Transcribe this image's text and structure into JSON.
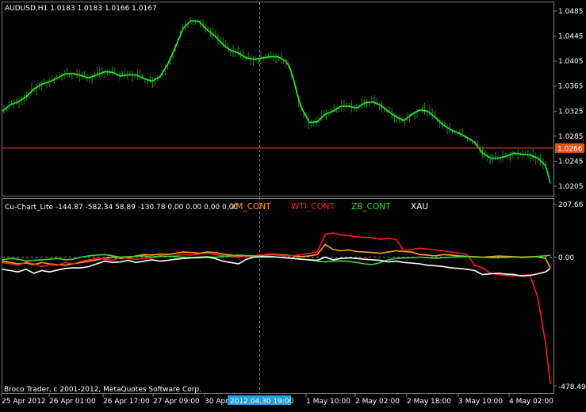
{
  "colors": {
    "background": "#000000",
    "frame": "#808080",
    "text": "#ffffff",
    "price": "#22ee22",
    "price_bars": "#1f8a1f",
    "current_price_line": "#e0531b",
    "current_price_badge": "#e0531b",
    "crosshair": "#5a8fd6",
    "date_highlight": "#1fa0e0",
    "ym": "#ff9f1a",
    "wti": "#ff1a1a",
    "zb": "#33dd33",
    "xau": "#ffffff"
  },
  "main": {
    "header": "AUDUSD,H1  1.0183 1.0183 1.0166 1.0167",
    "current_price": "1.0266",
    "price_axis": [
      "1.0485",
      "1.0445",
      "1.0405",
      "1.0365",
      "1.0325",
      "1.0285",
      "1.0245",
      "1.0205"
    ]
  },
  "sub": {
    "header": "Cu-Chart_Lite -144.87 -582.34 58.89 -130.78 0.00 0.00 0.00 0.00",
    "legend": [
      {
        "label": "YM_CONT",
        "color": "#ff9f1a"
      },
      {
        "label": "WTI_CONT",
        "color": "#ff1a1a"
      },
      {
        "label": "ZB_CONT",
        "color": "#33dd33"
      },
      {
        "label": "XAU",
        "color": "#ffffff"
      }
    ],
    "axis": {
      "top": "207.66",
      "zero": "0.00",
      "bottom": "-478.49"
    },
    "copyright": "Broco Trader, c 2001-2012, MetaQuotes Software Corp."
  },
  "time_axis": {
    "labels": [
      "25 Apr 2012",
      "26 Apr 01:00",
      "26 Apr 17:00",
      "27 Apr 09:00",
      "30 Apr",
      "1 May 10:00",
      "2 May 02:00",
      "2 May 18:00",
      "3 May 10:00",
      "4 May 02:00"
    ],
    "highlighted": "2012.04.30 19:00"
  },
  "chart_data": [
    {
      "type": "line",
      "title": "AUDUSD,H1",
      "ylim": [
        1.0195,
        1.0495
      ],
      "series": [
        {
          "name": "AUDUSD",
          "x": [
            0,
            10,
            20,
            30,
            40,
            50,
            60,
            70,
            80,
            90,
            100,
            110,
            120,
            130,
            140,
            150,
            160,
            170,
            180,
            190,
            200,
            210,
            220,
            230,
            240,
            250,
            260,
            270,
            280,
            290,
            300,
            310,
            320,
            330,
            340,
            350,
            360,
            365,
            370,
            375,
            380,
            390,
            400,
            410,
            420,
            430,
            440,
            450,
            460,
            470,
            480,
            490,
            500,
            510,
            520,
            530,
            540,
            550,
            560,
            570,
            580,
            590,
            600,
            610,
            620,
            630,
            640,
            650,
            660,
            670,
            680,
            690,
            696
          ],
          "y": [
            1.0325,
            1.0335,
            1.034,
            1.0348,
            1.036,
            1.0368,
            1.0372,
            1.0378,
            1.0385,
            1.0385,
            1.0382,
            1.0378,
            1.0383,
            1.0388,
            1.0387,
            1.0381,
            1.0383,
            1.0383,
            1.0377,
            1.0373,
            1.038,
            1.04,
            1.0428,
            1.0458,
            1.047,
            1.0468,
            1.0455,
            1.0445,
            1.0432,
            1.0422,
            1.0418,
            1.041,
            1.0408,
            1.041,
            1.0412,
            1.0412,
            1.0405,
            1.0395,
            1.0375,
            1.035,
            1.033,
            1.0307,
            1.0308,
            1.032,
            1.0325,
            1.0333,
            1.0333,
            1.033,
            1.0338,
            1.034,
            1.0335,
            1.0325,
            1.0316,
            1.031,
            1.032,
            1.0327,
            1.0325,
            1.0315,
            1.0303,
            1.0295,
            1.029,
            1.0283,
            1.0275,
            1.0258,
            1.025,
            1.025,
            1.0253,
            1.0258,
            1.0256,
            1.0255,
            1.025,
            1.0238,
            1.021
          ]
        }
      ]
    },
    {
      "type": "line",
      "title": "Cu-Chart_Lite",
      "ylim": [
        -478.49,
        207.66
      ],
      "x": [
        0,
        10,
        20,
        30,
        40,
        50,
        60,
        70,
        80,
        90,
        100,
        110,
        120,
        130,
        140,
        150,
        160,
        170,
        180,
        190,
        200,
        210,
        220,
        230,
        240,
        250,
        260,
        270,
        280,
        290,
        300,
        310,
        320,
        330,
        340,
        350,
        360,
        370,
        380,
        390,
        400,
        410,
        420,
        430,
        440,
        450,
        460,
        470,
        480,
        490,
        500,
        510,
        520,
        530,
        540,
        550,
        560,
        570,
        580,
        590,
        600,
        610,
        620,
        630,
        640,
        650,
        660,
        670,
        680,
        690,
        696
      ],
      "series": [
        {
          "name": "YM_CONT",
          "y": [
            -15,
            -20,
            -25,
            -22,
            -28,
            -20,
            -25,
            -28,
            -30,
            -25,
            -20,
            -15,
            -10,
            -5,
            0,
            -5,
            -2,
            5,
            10,
            8,
            12,
            10,
            15,
            20,
            18,
            15,
            20,
            18,
            12,
            8,
            5,
            3,
            5,
            8,
            12,
            10,
            8,
            5,
            2,
            5,
            10,
            50,
            30,
            25,
            28,
            22,
            20,
            18,
            15,
            20,
            25,
            22,
            20,
            10,
            8,
            5,
            10,
            8,
            5,
            3,
            2,
            0,
            2,
            4,
            3,
            2,
            0,
            2,
            1,
            -5,
            -40
          ]
        },
        {
          "name": "WTI_CONT",
          "y": [
            -20,
            -25,
            -30,
            -18,
            -25,
            -35,
            -28,
            -30,
            -20,
            -25,
            -15,
            -10,
            -5,
            -8,
            -12,
            0,
            -5,
            -8,
            -5,
            -2,
            0,
            3,
            5,
            10,
            8,
            12,
            15,
            10,
            5,
            2,
            0,
            3,
            5,
            8,
            10,
            8,
            5,
            6,
            10,
            15,
            20,
            90,
            95,
            88,
            84,
            80,
            78,
            76,
            70,
            74,
            70,
            25,
            30,
            35,
            32,
            28,
            25,
            20,
            16,
            10,
            -30,
            -40,
            -60,
            -65,
            -68,
            -70,
            -68,
            -66,
            -150,
            -320,
            -472
          ]
        },
        {
          "name": "ZB_CONT",
          "y": [
            -10,
            -5,
            -8,
            -15,
            -12,
            -10,
            -8,
            -5,
            -10,
            -8,
            0,
            5,
            8,
            10,
            5,
            0,
            2,
            3,
            5,
            0,
            5,
            3,
            2,
            0,
            -2,
            0,
            2,
            -1,
            3,
            5,
            8,
            6,
            5,
            4,
            3,
            0,
            -2,
            -5,
            -8,
            -10,
            -15,
            -18,
            -15,
            -14,
            -16,
            -20,
            -25,
            -28,
            -20,
            -10,
            -5,
            -3,
            -2,
            0,
            -2,
            -4,
            -2,
            0,
            1,
            2,
            0,
            -1,
            -2,
            -3,
            -1,
            0,
            -2,
            0,
            3,
            5,
            8
          ]
        },
        {
          "name": "XAU",
          "y": [
            -45,
            -50,
            -55,
            -45,
            -60,
            -50,
            -55,
            -48,
            -42,
            -40,
            -40,
            -35,
            -25,
            -15,
            -20,
            -18,
            -12,
            -20,
            -15,
            -10,
            -15,
            -12,
            -8,
            -5,
            -3,
            -2,
            0,
            -5,
            -15,
            -20,
            -25,
            -8,
            0,
            2,
            1,
            0,
            -3,
            -5,
            -8,
            -10,
            -12,
            0,
            -10,
            -5,
            -3,
            -5,
            -8,
            -10,
            -12,
            -18,
            -15,
            -20,
            -22,
            -25,
            -30,
            -32,
            -35,
            -40,
            -42,
            -45,
            -50,
            -65,
            -62,
            -60,
            -63,
            -65,
            -70,
            -68,
            -62,
            -55,
            -42
          ]
        }
      ]
    }
  ]
}
